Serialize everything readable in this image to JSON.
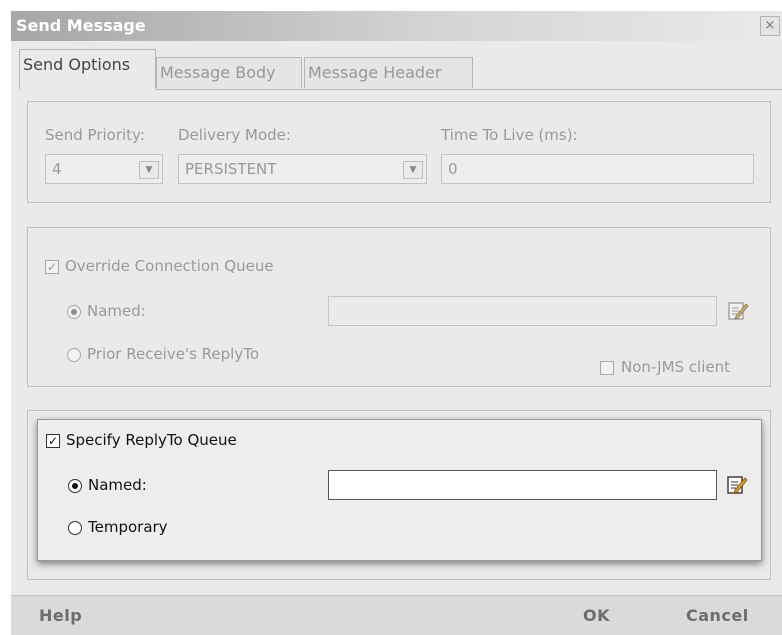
{
  "window": {
    "title": "Send Message",
    "close_glyph": "×"
  },
  "tabs": [
    {
      "label": "Send Options",
      "active": true
    },
    {
      "label": "Message Body",
      "active": false
    },
    {
      "label": "Message Header",
      "active": false
    }
  ],
  "send": {
    "priority_label": "Send Priority:",
    "priority_value": "4",
    "delivery_label": "Delivery Mode:",
    "delivery_value": "PERSISTENT",
    "ttl_label": "Time To Live (ms):",
    "ttl_value": "0",
    "dropdown_glyph": "▼"
  },
  "override": {
    "label": "Override Connection Queue",
    "checked": true,
    "named_label": "Named:",
    "named_value": "",
    "prior_label": "Prior Receive's ReplyTo",
    "nonjms_label": "Non-JMS client"
  },
  "reply": {
    "label": "Specify ReplyTo Queue",
    "checked": true,
    "named_label": "Named:",
    "named_value": "",
    "temporary_label": "Temporary"
  },
  "footer": {
    "help": "Help",
    "ok": "OK",
    "cancel": "Cancel"
  },
  "check_glyph": "✓"
}
